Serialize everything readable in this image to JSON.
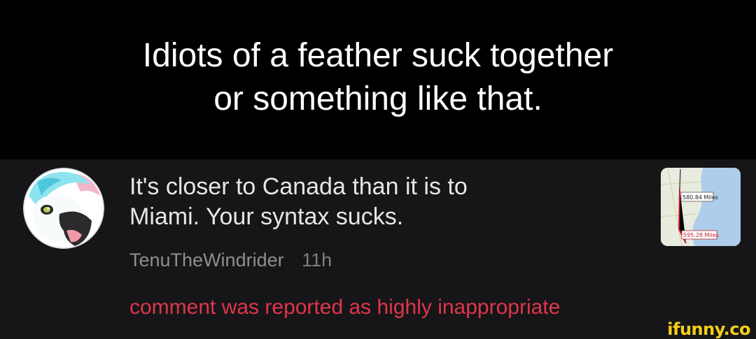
{
  "caption": {
    "line1": "Idiots of a feather suck together",
    "line2": "or something like that."
  },
  "comment": {
    "text_line1": "It's closer to Canada than it is to",
    "text_line2": "Miami. Your syntax sucks.",
    "username": "TenuTheWindrider",
    "time": "11h",
    "reported": "comment was reported as highly inappropriate",
    "thumbnail": {
      "label_top": "580.84 Miles",
      "label_bottom": "595.28 Miles"
    }
  },
  "watermark": "ifunny.co",
  "colors": {
    "background": "#000000",
    "comment_background": "#161618",
    "reported": "#e0354b",
    "watermark": "#f3cf19"
  }
}
